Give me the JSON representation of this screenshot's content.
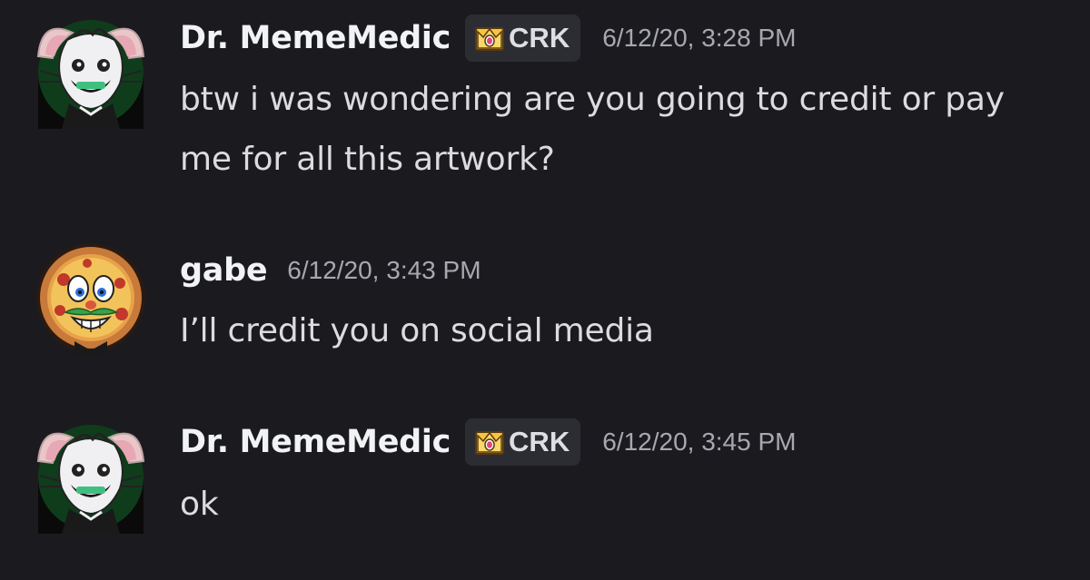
{
  "messages": [
    {
      "author": "Dr. MemeMedic",
      "avatar_icon": "white-cat-avatar-icon",
      "tag": {
        "icon": "crown-gem-icon",
        "label": "CRK"
      },
      "timestamp": "6/12/20, 3:28 PM",
      "text": "btw i was wondering are you going to credit or pay me for all this artwork?"
    },
    {
      "author": "gabe",
      "avatar_icon": "pizza-face-avatar-icon",
      "timestamp": "6/12/20, 3:43 PM",
      "text": "I’ll credit you on social media"
    },
    {
      "author": "Dr. MemeMedic",
      "avatar_icon": "white-cat-avatar-icon",
      "tag": {
        "icon": "crown-gem-icon",
        "label": "CRK"
      },
      "timestamp": "6/12/20, 3:45 PM",
      "text": "ok"
    }
  ],
  "colors": {
    "background": "#1b1b1f",
    "username": "#f2f3f5",
    "timestamp": "#a7a8b0",
    "message_text": "#dcdce0",
    "tag_background": "#2c2c33"
  }
}
